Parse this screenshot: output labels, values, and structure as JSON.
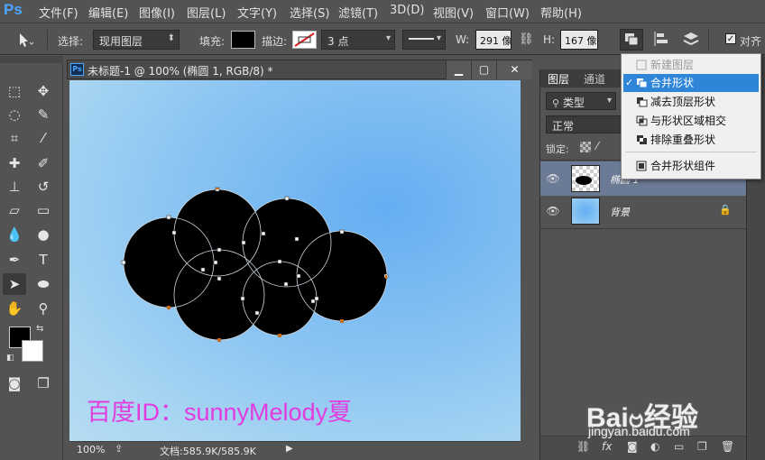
{
  "app": {
    "logo": "Ps"
  },
  "menubar": {
    "items": [
      "文件(F)",
      "编辑(E)",
      "图像(I)",
      "图层(L)",
      "文字(Y)",
      "选择(S)",
      "滤镜(T)",
      "3D(D)",
      "视图(V)",
      "窗口(W)",
      "帮助(H)"
    ]
  },
  "options": {
    "select_label": "选择:",
    "select_value": "现用图层",
    "fill_label": "填充:",
    "stroke_label": "描边:",
    "stroke_size": "3 点",
    "w_label": "W:",
    "w_value": "291 像",
    "h_label": "H:",
    "h_value": "167 像",
    "align_edges": "对齐"
  },
  "document": {
    "title": "未标题-1 @ 100% (椭圆 1, RGB/8) *",
    "zoom": "100%",
    "doc_info": "文档:585.9K/585.9K",
    "canvas_text": "百度ID：sunnyMelody夏"
  },
  "layers_panel": {
    "tabs": [
      "图层",
      "通道"
    ],
    "filter_kind": "类型",
    "blend_mode": "正常",
    "lock_label": "锁定:",
    "layers": [
      {
        "name": "椭圆 1",
        "selected": true
      },
      {
        "name": "背景",
        "selected": false,
        "locked": true
      }
    ],
    "footer_icons": [
      "link-icon",
      "fx-icon",
      "mask-icon",
      "adjustment-icon",
      "folder-icon",
      "new-layer-icon",
      "trash-icon"
    ]
  },
  "path_ops_menu": {
    "items": [
      {
        "label": "新建图层",
        "disabled": true,
        "checked": false,
        "highlighted": false
      },
      {
        "label": "合并形状",
        "disabled": false,
        "checked": true,
        "highlighted": true
      },
      {
        "label": "减去顶层形状",
        "disabled": false,
        "checked": false,
        "highlighted": false
      },
      {
        "label": "与形状区域相交",
        "disabled": false,
        "checked": false,
        "highlighted": false
      },
      {
        "label": "排除重叠形状",
        "disabled": false,
        "checked": false,
        "highlighted": false
      },
      {
        "label": "合并形状组件",
        "disabled": false,
        "checked": false,
        "highlighted": false
      }
    ]
  },
  "watermark": {
    "baidu_logo": "Baiဗ经验",
    "url": "jingyan.baidu.com"
  },
  "colors": {
    "accent": "#2f86d8",
    "canvas_text": "#e23ce0",
    "shape_fill": "#000000"
  }
}
